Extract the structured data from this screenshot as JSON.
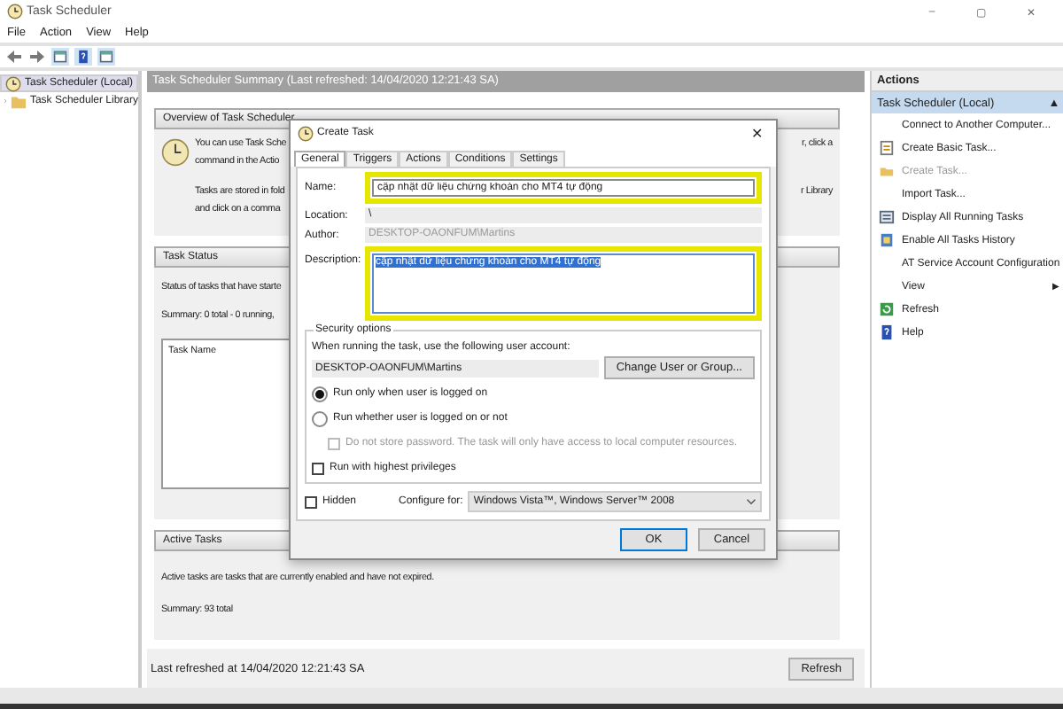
{
  "window": {
    "title": "Task Scheduler",
    "controls": [
      "–",
      "▢",
      "✕"
    ]
  },
  "menu": [
    "File",
    "Action",
    "View",
    "Help"
  ],
  "tree": [
    {
      "label": "Task Scheduler (Local)",
      "selected": true,
      "children": [
        {
          "label": "Task Scheduler Library",
          "selected": false
        }
      ]
    }
  ],
  "summary": {
    "header": "Task Scheduler Summary (Last refreshed: 14/04/2020 12:21:43 SA)",
    "sections": [
      {
        "title": "Overview of Task Scheduler",
        "kind": "overview",
        "lines": [
          {
            "left": "You can use Task Sche",
            "right": "r, click a"
          },
          {
            "left": "command in the Actio"
          },
          {
            "left": "Tasks are stored in fold",
            "right": "r Library"
          },
          {
            "left": "and click on a comma"
          }
        ]
      },
      {
        "title": "Task Status",
        "kind": "status",
        "lines": [
          {
            "left": "Status of tasks that have starte"
          },
          {
            "left": "Summary: 0 total - 0 running,"
          }
        ],
        "column": "Task Name"
      },
      {
        "title": "Active Tasks",
        "kind": "active",
        "lines": [
          {
            "left": "Active tasks are tasks that are currently enabled and have not expired."
          },
          {
            "left": "Summary: 93 total"
          }
        ]
      }
    ],
    "footer": "Last refreshed at 14/04/2020 12:21:43 SA",
    "refresh": "Refresh"
  },
  "actions": {
    "header": "Actions",
    "section": "Task Scheduler (Local)",
    "collapse": "▲",
    "items": [
      {
        "label": "Connect to Another Computer...",
        "disabled": false
      },
      {
        "label": "Create Basic Task...",
        "disabled": false
      },
      {
        "label": "Create Task...",
        "disabled": true
      },
      {
        "label": "Import Task...",
        "disabled": false
      },
      {
        "label": "Display All Running Tasks",
        "disabled": false
      },
      {
        "label": "Enable All Tasks History",
        "disabled": false
      },
      {
        "label": "AT Service Account Configuration",
        "disabled": false
      },
      {
        "label": "View",
        "disabled": false,
        "submenu": "▶"
      },
      {
        "label": "Refresh",
        "disabled": false
      },
      {
        "label": "Help",
        "disabled": false
      }
    ]
  },
  "dialog": {
    "title": "Create Task",
    "close": "✕",
    "tabs": [
      {
        "label": "General",
        "selected": true
      },
      {
        "label": "Triggers",
        "selected": false
      },
      {
        "label": "Actions",
        "selected": false
      },
      {
        "label": "Conditions",
        "selected": false
      },
      {
        "label": "Settings",
        "selected": false
      }
    ],
    "name": {
      "label": "Name:",
      "value": "cập nhật dữ liệu chứng khoán cho MT4 tự động",
      "highlighted": true
    },
    "location": {
      "label": "Location:",
      "value": "\\"
    },
    "author": {
      "label": "Author:",
      "value": "DESKTOP-OAONFUM\\Martins"
    },
    "description": {
      "label": "Description:",
      "value": "cập nhật dữ liệu chứng khoán cho MT4 tự động",
      "highlighted": true
    },
    "security": {
      "title": "Security options",
      "account_prompt": "When running the task, use the following user account:",
      "account": "DESKTOP-OAONFUM\\Martins",
      "change_button": "Change User or Group...",
      "options": [
        {
          "kind": "radio",
          "label": "Run only when user is logged on",
          "selected": true,
          "disabled": false
        },
        {
          "kind": "radio",
          "label": "Run whether user is logged on or not",
          "selected": false,
          "disabled": false
        },
        {
          "kind": "checkbox",
          "label": "Do not store password.  The task will only have access to local computer resources.",
          "checked": false,
          "disabled": true
        },
        {
          "kind": "checkbox",
          "label": "Run with highest privileges",
          "checked": false,
          "disabled": false
        }
      ]
    },
    "hidden": {
      "label": "Hidden",
      "checked": false
    },
    "configure": {
      "label": "Configure for:",
      "value": "Windows Vista™, Windows Server™ 2008"
    },
    "buttons": [
      {
        "label": "OK",
        "default": true
      },
      {
        "label": "Cancel",
        "default": false
      }
    ]
  }
}
